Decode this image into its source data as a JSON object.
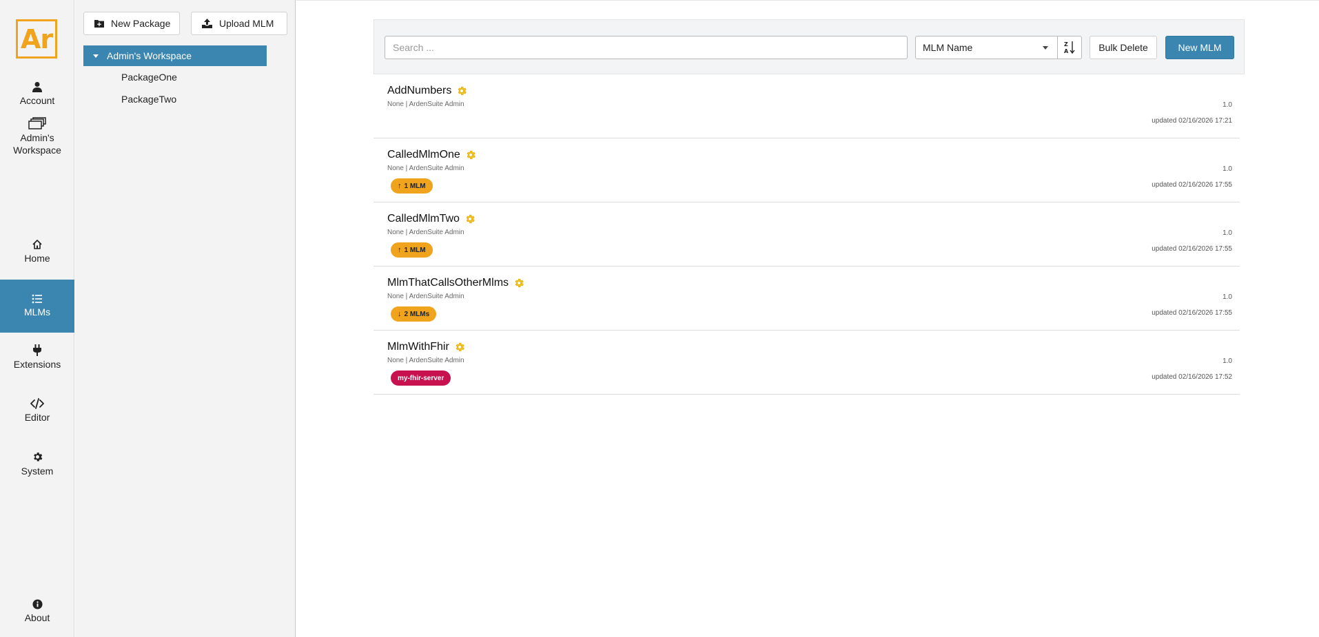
{
  "nav": {
    "logo": "Ar",
    "account": "Account",
    "workspace_line1": "Admin's",
    "workspace_line2": "Workspace",
    "home": "Home",
    "mlms": "MLMs",
    "extensions": "Extensions",
    "editor": "Editor",
    "system": "System",
    "about": "About"
  },
  "panel": {
    "new_package": "New Package",
    "upload_mlm": "Upload MLM",
    "workspace": "Admin's Workspace",
    "packages": [
      "PackageOne",
      "PackageTwo"
    ]
  },
  "toolbar": {
    "search_placeholder": "Search ...",
    "sort_field": "MLM Name",
    "bulk_delete": "Bulk Delete",
    "new_mlm": "New MLM"
  },
  "mlms": [
    {
      "name": "AddNumbers",
      "meta": "None | ArdenSuite Admin",
      "version": "1.0",
      "updated": "updated 02/16/2026 17:21",
      "badge": null
    },
    {
      "name": "CalledMlmOne",
      "meta": "None | ArdenSuite Admin",
      "version": "1.0",
      "updated": "updated 02/16/2026 17:55",
      "badge": {
        "arrow": "↑",
        "text": "1 MLM",
        "color": "#f0a31c"
      }
    },
    {
      "name": "CalledMlmTwo",
      "meta": "None | ArdenSuite Admin",
      "version": "1.0",
      "updated": "updated 02/16/2026 17:55",
      "badge": {
        "arrow": "↑",
        "text": "1 MLM",
        "color": "#f0a31c"
      }
    },
    {
      "name": "MlmThatCallsOtherMlms",
      "meta": "None | ArdenSuite Admin",
      "version": "1.0",
      "updated": "updated 02/16/2026 17:55",
      "badge": {
        "arrow": "↓",
        "text": "2 MLMs",
        "color": "#f0a31c"
      }
    },
    {
      "name": "MlmWithFhir",
      "meta": "None | ArdenSuite Admin",
      "version": "1.0",
      "updated": "updated 02/16/2026 17:52",
      "badge": {
        "arrow": "",
        "text": "my-fhir-server",
        "color": "#c8124f"
      }
    }
  ],
  "colors": {
    "accent": "#3b86b0",
    "brand": "#f0a31c",
    "fhir": "#c8124f"
  }
}
